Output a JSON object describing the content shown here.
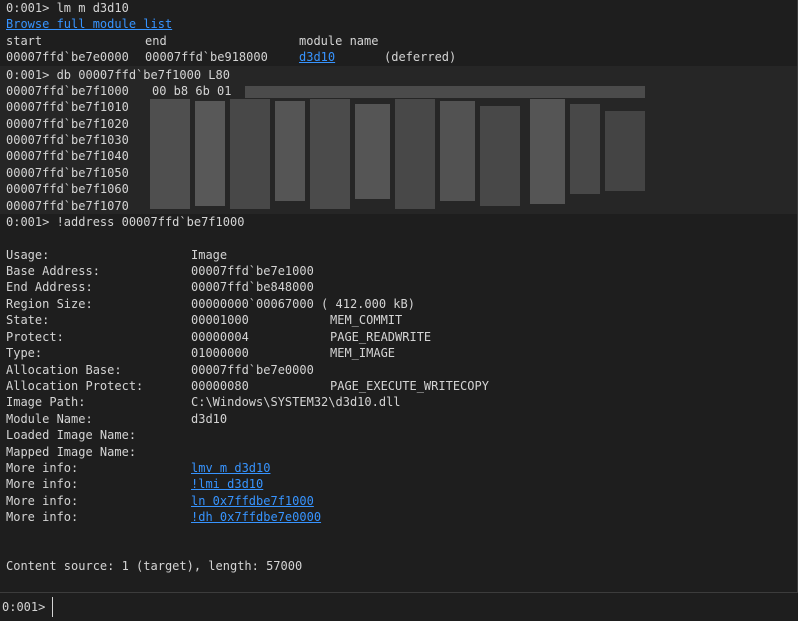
{
  "session": {
    "lm_cmd": "0:001> lm m d3d10",
    "browse_link": "Browse full module list",
    "hdr_start": "start",
    "hdr_end": "end",
    "hdr_module": "module name",
    "mod_start": "00007ffd`be7e0000",
    "mod_end": "00007ffd`be918000",
    "mod_name": "d3d10",
    "mod_status": "(deferred)",
    "db_cmd": "0:001> db 00007ffd`be7f1000 L80",
    "db_addrs": [
      "00007ffd`be7f1000",
      "00007ffd`be7f1010",
      "00007ffd`be7f1020",
      "00007ffd`be7f1030",
      "00007ffd`be7f1040",
      "00007ffd`be7f1050",
      "00007ffd`be7f1060",
      "00007ffd`be7f1070"
    ],
    "db_first_bytes": "00 b8 6b 01",
    "address_cmd": "0:001> !address 00007ffd`be7f1000",
    "props": {
      "usage_k": "Usage:",
      "usage_v": "Image",
      "base_k": "Base Address:",
      "base_v": "00007ffd`be7e1000",
      "end_k": "End Address:",
      "end_v": "00007ffd`be848000",
      "size_k": "Region Size:",
      "size_v": "00000000`00067000 ( 412.000 kB)",
      "state_k": "State:",
      "state_v": "00001000",
      "state_n": "MEM_COMMIT",
      "protect_k": "Protect:",
      "protect_v": "00000004",
      "protect_n": "PAGE_READWRITE",
      "type_k": "Type:",
      "type_v": "01000000",
      "type_n": "MEM_IMAGE",
      "allocbase_k": "Allocation Base:",
      "allocbase_v": "00007ffd`be7e0000",
      "allocprot_k": "Allocation Protect:",
      "allocprot_v": "00000080",
      "allocprot_n": "PAGE_EXECUTE_WRITECOPY",
      "path_k": "Image Path:",
      "path_v": "C:\\Windows\\SYSTEM32\\d3d10.dll",
      "modname_k": "Module Name:",
      "modname_v": "d3d10",
      "loaded_k": "Loaded Image Name:",
      "mapped_k": "Mapped Image Name:",
      "more_k": "More info:",
      "more_links": [
        "lmv m d3d10",
        "!lmi d3d10",
        "ln 0x7ffdbe7f1000",
        "!dh 0x7ffdbe7e0000"
      ]
    },
    "content_source": "Content source: 1 (target), length: 57000"
  },
  "prompt": {
    "label": "0:001>",
    "value": ""
  }
}
